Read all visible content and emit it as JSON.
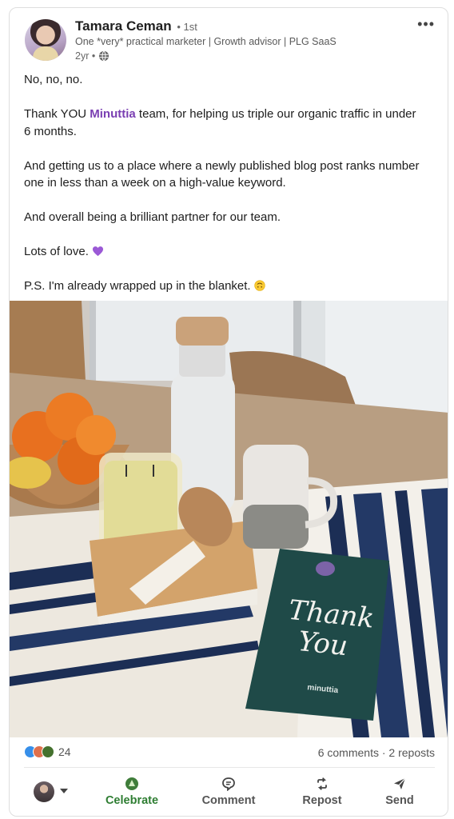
{
  "post": {
    "author": {
      "name": "Tamara Ceman",
      "degree": "• 1st",
      "headline": "One *very* practical marketer | Growth advisor | PLG SaaS",
      "age": "2yr •",
      "visibility_icon": "globe-icon"
    },
    "menu_icon": "more-icon",
    "text": {
      "p1": "No, no, no.",
      "p2_before": "Thank YOU ",
      "p2_mention": "Minuttia",
      "p2_after": " team, for helping us triple our organic traffic in under 6 months.",
      "p3": "And getting us to a place where a newly published blog post ranks number one in less than a week on a high-value keyword.",
      "p4": "And overall being a brilliant partner for our team.",
      "p5": "Lots of love.",
      "p6": "P.S. I'm already wrapped up in the blanket."
    },
    "photo": {
      "card_line1": "Thank",
      "card_line2": "You",
      "card_brand": "minuttia"
    },
    "social": {
      "reaction_count": "24",
      "comments_reposts": "6 comments · 2 reposts",
      "reaction_colors": [
        "#378fe9",
        "#df704d",
        "#44712e"
      ]
    },
    "actions": {
      "celebrate": "Celebrate",
      "comment": "Comment",
      "repost": "Repost",
      "send": "Send"
    }
  }
}
